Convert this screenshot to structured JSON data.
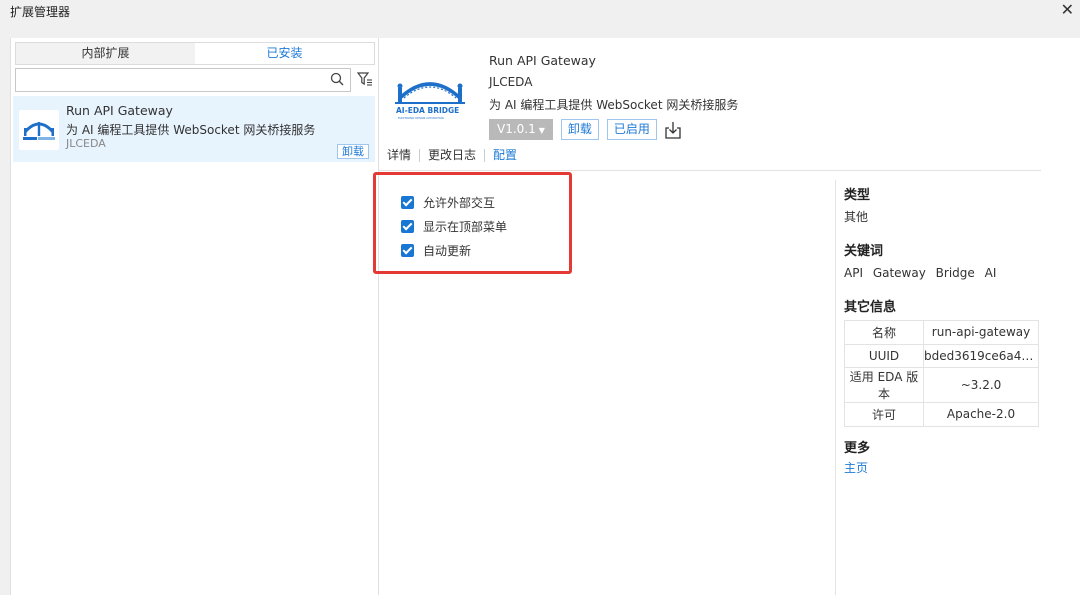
{
  "window": {
    "title": "扩展管理器",
    "close": "✕"
  },
  "left": {
    "tabs": [
      {
        "label": "内部扩展"
      },
      {
        "label": "已安装"
      }
    ],
    "search": {
      "value": "",
      "placeholder": ""
    },
    "item": {
      "name": "Run API Gateway",
      "desc": "为 AI 编程工具提供 WebSocket 网关桥接服务",
      "author": "JLCEDA",
      "uninstall": "卸载"
    }
  },
  "detail": {
    "name": "Run API Gateway",
    "author": "JLCEDA",
    "desc": "为 AI 编程工具提供 WebSocket 网关桥接服务",
    "version": "V1.0.1",
    "uninstall": "卸载",
    "enabled": "已启用",
    "logo_text": "AI-EDA BRIDGE",
    "logo_subtext": "ELECTRONIC DESIGN AUTOMATION",
    "subtabs": [
      {
        "label": "详情"
      },
      {
        "label": "更改日志"
      },
      {
        "label": "配置"
      }
    ],
    "settings": [
      {
        "label": "允许外部交互",
        "checked": true
      },
      {
        "label": "显示在顶部菜单",
        "checked": true
      },
      {
        "label": "自动更新",
        "checked": true
      }
    ]
  },
  "side": {
    "type_h": "类型",
    "type_v": "其他",
    "kw_h": "关键词",
    "keywords": [
      "API",
      "Gateway",
      "Bridge",
      "AI"
    ],
    "info_h": "其它信息",
    "info": [
      {
        "k": "名称",
        "v": "run-api-gateway"
      },
      {
        "k": "UUID",
        "v": "bded3619ce6a4e6…"
      },
      {
        "k": "适用 EDA 版本",
        "v": "~3.2.0"
      },
      {
        "k": "许可",
        "v": "Apache-2.0"
      }
    ],
    "more_h": "更多",
    "home": "主页"
  },
  "colors": {
    "accent": "#1e7ad6",
    "highlight_row": "#e7f3fd",
    "annotation": "#e53935"
  }
}
